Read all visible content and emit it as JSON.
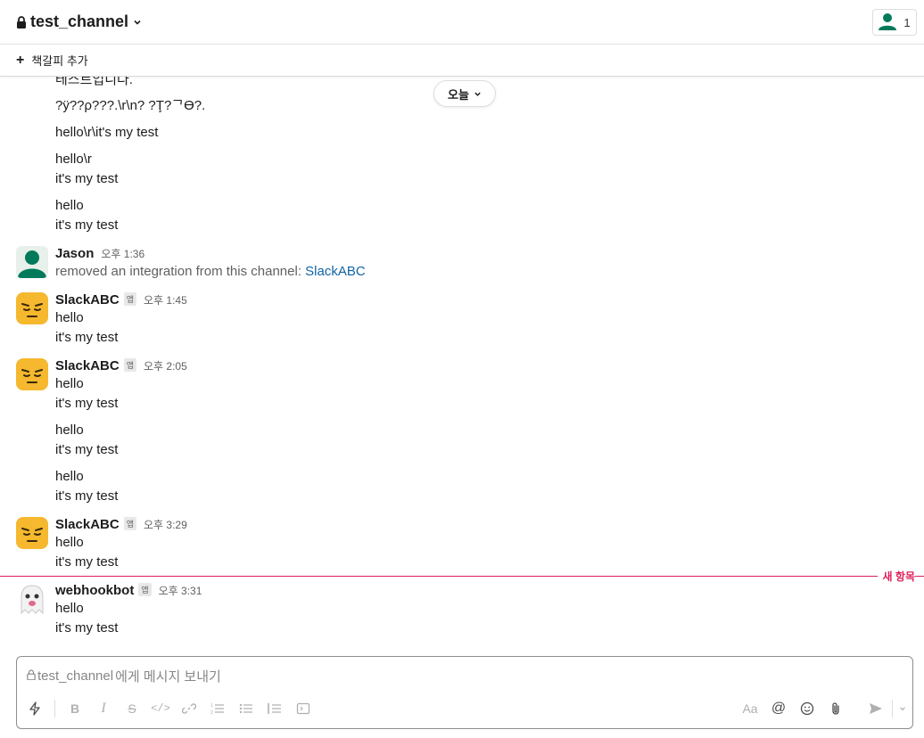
{
  "header": {
    "channel_name": "test_channel",
    "member_count": "1"
  },
  "bookmarks": {
    "add_label": "책갈피 추가"
  },
  "date_pill": "오늘",
  "messages": {
    "m0": "테스트입니다.",
    "m1": "?ÿ??ρ???.\\r\\n?    ?Ţ?ᄀϴ?.",
    "m2": "hello\\r\\it's my test",
    "m3a": "hello\\r",
    "m3b": "it's my test",
    "m4a": "hello",
    "m4b": "it's my test",
    "jason": {
      "name": "Jason",
      "time": "오후 1:36",
      "text": "removed an integration from this channel: ",
      "link": "SlackABC"
    },
    "s1": {
      "name": "SlackABC",
      "badge": "앱",
      "time": "오후 1:45",
      "l1": "hello",
      "l2": "it's my test"
    },
    "s2": {
      "name": "SlackABC",
      "badge": "앱",
      "time": "오후 2:05",
      "l1": "hello",
      "l2": "it's my test",
      "l3": "hello",
      "l4": "it's my test",
      "l5": "hello",
      "l6": "it's my test"
    },
    "s3": {
      "name": "SlackABC",
      "badge": "앱",
      "time": "오후 3:29",
      "l1": "hello",
      "l2": "it's my test"
    },
    "webhook": {
      "name": "webhookbot",
      "badge": "앱",
      "time": "오후 3:31",
      "l1": "hello",
      "l2": "it's my test"
    }
  },
  "new_divider_label": "새 항목",
  "composer": {
    "placeholder_channel": "test_channel",
    "placeholder_suffix": "에게 메시지 보내기",
    "format_label": "Aa"
  },
  "colors": {
    "accent_red": "#e01e5a",
    "link_blue": "#1264a3",
    "avatar_green": "#007a5a",
    "emoji_yellow": "#f5b82e"
  },
  "icons": [
    "lock-icon",
    "chevron-down-icon",
    "user-icon",
    "plus-icon",
    "lightning-icon",
    "bold-icon",
    "italic-icon",
    "strikethrough-icon",
    "code-icon",
    "link-icon",
    "ordered-list-icon",
    "bullet-list-icon",
    "blockquote-icon",
    "code-block-icon",
    "mention-icon",
    "emoji-icon",
    "attach-icon",
    "send-icon"
  ]
}
